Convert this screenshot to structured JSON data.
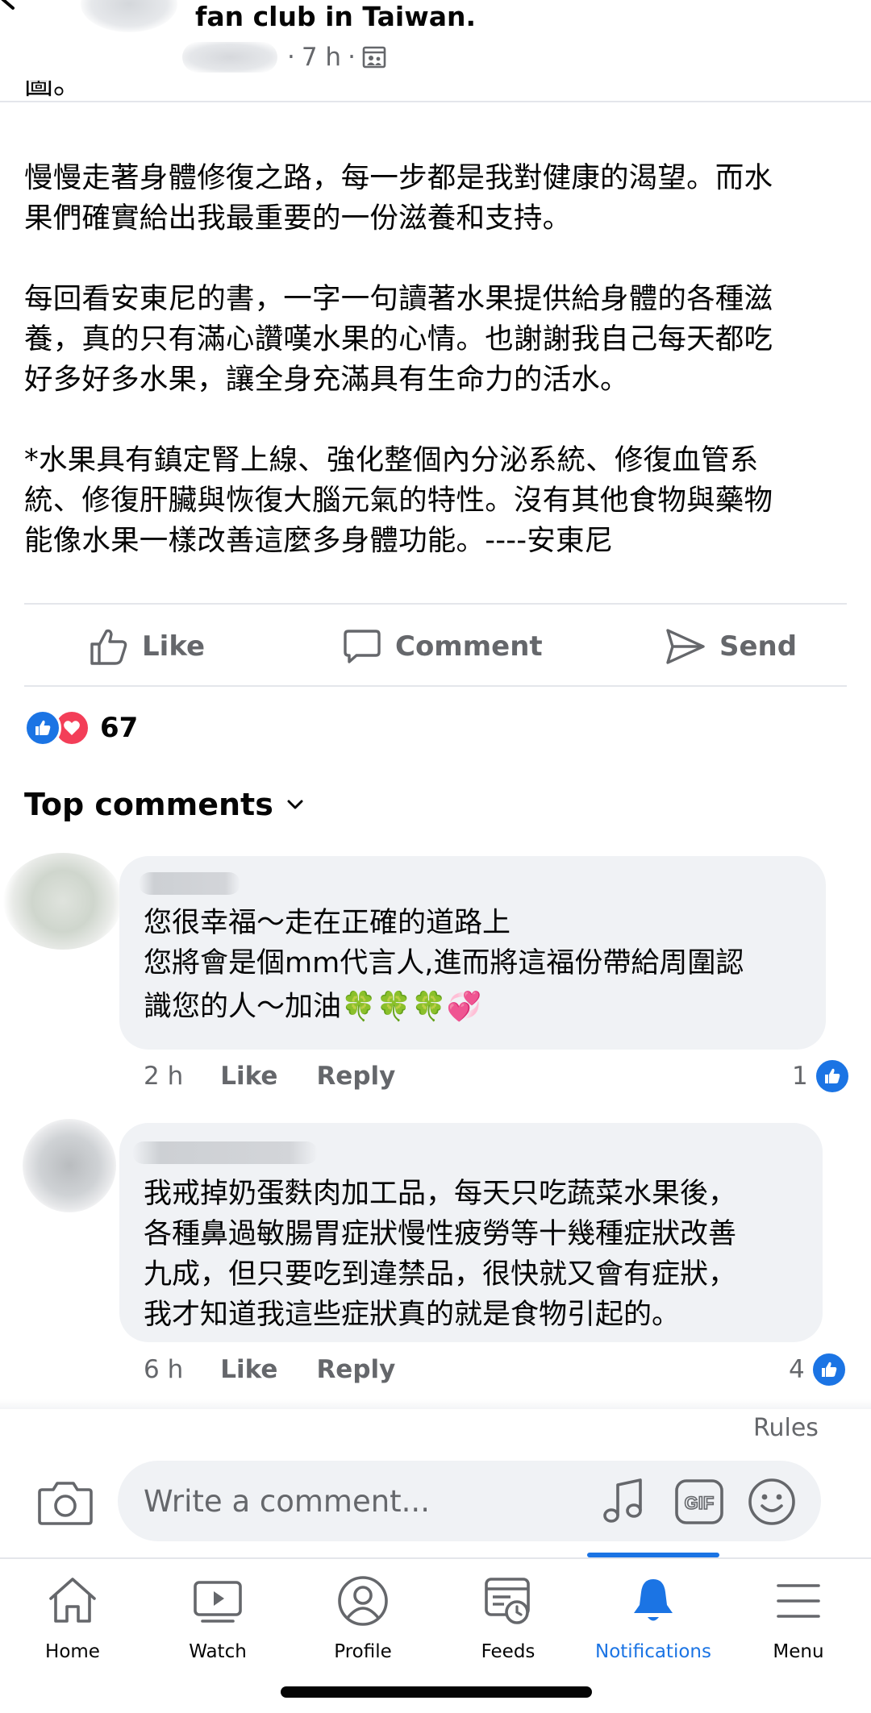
{
  "header": {
    "title": "fan club in Taiwan.",
    "time": "7 h",
    "sep": "·"
  },
  "post": {
    "partial_line": "圖。",
    "paragraphs": [
      [
        "慢慢走著身體修復之路，每一步都是我對健康的渴望。而水",
        "果們確實給出我最重要的一份滋養和支持。"
      ],
      [
        "每回看安東尼的書，一字一句讀著水果提供給身體的各種滋",
        "養，真的只有滿心讚嘆水果的心情。也謝謝我自己每天都吃",
        "好多好多水果，讓全身充滿具有生命力的活水。"
      ],
      [
        "*水果具有鎮定腎上線、強化整個內分泌系統、修復血管系",
        "統、修復肝臟與恢復大腦元氣的特性。沒有其他食物與藥物",
        "能像水果一樣改善這麼多身體功能。----安東尼"
      ]
    ]
  },
  "actions": {
    "like": "Like",
    "comment": "Comment",
    "send": "Send"
  },
  "reactions": {
    "count": "67"
  },
  "top_comments_label": "Top comments",
  "comments": [
    {
      "lines": [
        "您很幸福～走在正確的道路上",
        "您將會是個mm代言人,進而將這福份帶給周圍認",
        "識您的人～加油"
      ],
      "emoji": "🍀🍀🍀💞",
      "time": "2 h",
      "like": "Like",
      "reply": "Reply",
      "likes": "1"
    },
    {
      "lines": [
        "我戒掉奶蛋麩肉加工品，每天只吃蔬菜水果後，",
        "各種鼻過敏腸胃症狀慢性疲勞等十幾種症狀改善",
        "九成，但只要吃到違禁品，很快就又會有症狀，",
        "我才知道我這些症狀真的就是食物引起的。"
      ],
      "time": "6 h",
      "like": "Like",
      "reply": "Reply",
      "likes": "4"
    }
  ],
  "rules_label": "Rules",
  "composer": {
    "placeholder": "Write a comment..."
  },
  "nav": {
    "home": "Home",
    "watch": "Watch",
    "profile": "Profile",
    "feeds": "Feeds",
    "notifications": "Notifications",
    "menu": "Menu",
    "active": "notifications"
  },
  "colors": {
    "accent": "#1b74e4",
    "love": "#f33e58",
    "muted": "#65676b",
    "bubble": "#f0f2f5"
  }
}
